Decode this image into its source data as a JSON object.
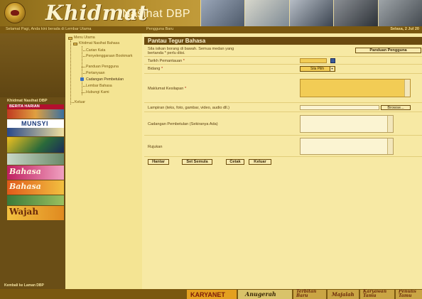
{
  "header": {
    "brand": "Khidmat",
    "subtitle": "Nasihat DBP"
  },
  "topbar": {
    "left": "Selamat Pagi, Anda kini berada di Lembar Utama",
    "middle": "Pengguna Baru",
    "right": "Selasa, 2 Jul 20"
  },
  "left": {
    "section_label": "Khidmat Nasihat DBP",
    "banners": [
      {
        "text": "BERITA HARIAN",
        "color": "#b2102e"
      },
      {
        "text": "MUNSYI",
        "color": "#1a3a7a"
      },
      {
        "text": "Bahasa",
        "color": "#9a1a4a"
      },
      {
        "text": "Bahasa",
        "color": "#c0441a"
      },
      {
        "text": "Wajah",
        "color": "#6a2a0a"
      }
    ],
    "bottom_link": "Kembali ke Laman DBP"
  },
  "tree": {
    "root": "Menu Utama",
    "group": "Khidmat Nasihat Bahasa",
    "items": [
      "Carian Kata",
      "Penyelenggaraan Bookmark",
      "Panduan Pengguna",
      "Pertanyaan",
      "Cadangan Pembetulan",
      "Lembar Bahasa",
      "Hubungi Kami"
    ],
    "active_index": 4,
    "logout": "Keluar"
  },
  "form": {
    "title": "Pantau Tegur Bahasa",
    "instruction": "Sila isikan borang di bawah. Semua medan yang bertanda * perlu diisi.",
    "guide_button": "Panduan Pengguna",
    "fields": {
      "tarikh_label": "Tarikh Pemantauan",
      "bidang_label": "Bidang",
      "bidang_value": "Sila Pilih",
      "maklumat_label": "Maklumat Kesilapan",
      "lampiran_label": "Lampiran (teks, foto, gambar, video, audio dll.)",
      "browse_button": "Browse...",
      "cadangan_label": "Cadangan Pembetulan (Sekiranya Ada)",
      "rujukan_label": "Rujukan"
    },
    "required_mark": "*",
    "buttons": [
      "Hantar",
      "Set Semula",
      "Cetak",
      "Keluar"
    ]
  },
  "bottombar": {
    "items": [
      "KARYANET",
      "Anugerah",
      "Terbitan Baru",
      "Majalah",
      "Karyawan Tamu",
      "Penulis Tamu"
    ]
  }
}
